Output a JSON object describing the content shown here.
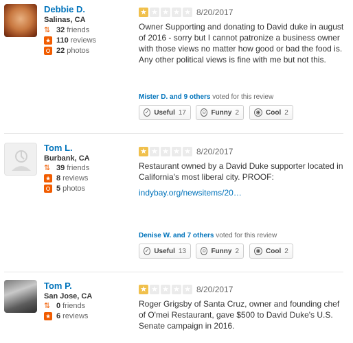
{
  "reviews": [
    {
      "user": {
        "name": "Debbie D.",
        "location": "Salinas, CA",
        "friends": "32",
        "reviews": "110",
        "photos": "22"
      },
      "date": "8/20/2017",
      "rating": 1,
      "text": "Owner Supporting and donating to David duke in august of 2016 - sorry but I cannot patronize a business owner with those views no matter how good or bad the food is. Any other political views is fine with me but not this.",
      "voted_by": "Mister D. and 9 others",
      "votes": {
        "useful": "17",
        "funny": "2",
        "cool": "2"
      }
    },
    {
      "user": {
        "name": "Tom L.",
        "location": "Burbank, CA",
        "friends": "39",
        "reviews": "8",
        "photos": "5"
      },
      "date": "8/20/2017",
      "rating": 1,
      "text": "Restaurant owned by a David Duke supporter located in California's most liberal city. PROOF:",
      "link": "indybay.org/newsitems/20…",
      "voted_by": "Denise W. and 7 others",
      "votes": {
        "useful": "13",
        "funny": "2",
        "cool": "2"
      }
    },
    {
      "user": {
        "name": "Tom P.",
        "location": "San Jose, CA",
        "friends": "0",
        "reviews": "6"
      },
      "date": "8/20/2017",
      "rating": 1,
      "text": "Roger Grigsby of Santa Cruz, owner and founding chef of O'mei Restaurant, gave $500 to David Duke's U.S. Senate campaign in 2016."
    }
  ],
  "labels": {
    "friends": "friends",
    "reviews": "reviews",
    "photos": "photos",
    "voted_suffix": "voted for this review",
    "useful": "Useful",
    "funny": "Funny",
    "cool": "Cool"
  },
  "icons": [
    "friends-icon",
    "review-icon",
    "photo-icon",
    "star-icon",
    "useful-icon",
    "funny-icon",
    "cool-icon"
  ],
  "colors": {
    "link": "#0073bb",
    "star": "#f0c04c",
    "accent": "#f15c00"
  }
}
